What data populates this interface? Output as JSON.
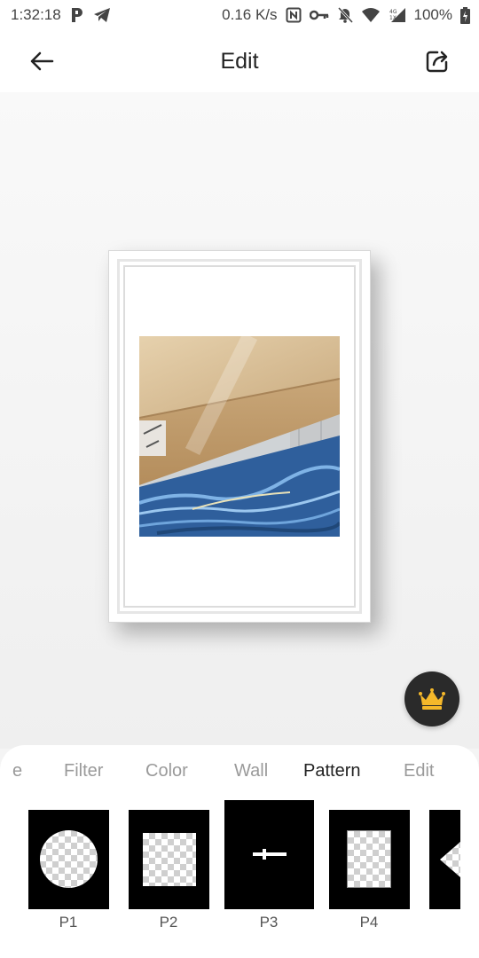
{
  "status_bar": {
    "time": "1:32:18",
    "net_speed": "0.16 K/s",
    "battery": "100%",
    "left_icons": [
      "p-app-icon",
      "telegram-icon"
    ],
    "right_icons": [
      "nfc-icon",
      "key-icon",
      "bell-off-icon",
      "wifi-icon",
      "signal-4g-icon",
      "battery-charging-icon"
    ]
  },
  "app_bar": {
    "title": "Edit",
    "back_icon": "arrow-left-icon",
    "share_icon": "share-icon"
  },
  "editor": {
    "frame_style": "white-frame",
    "premium_icon": "crown-icon",
    "accent_color": "#f5b82a"
  },
  "tabs": [
    {
      "label": "e",
      "active": false
    },
    {
      "label": "Filter",
      "active": false
    },
    {
      "label": "Color",
      "active": false
    },
    {
      "label": "Wall",
      "active": false
    },
    {
      "label": "Pattern",
      "active": true
    },
    {
      "label": "Edit",
      "active": false
    }
  ],
  "patterns": [
    {
      "label": "P1",
      "selected": false
    },
    {
      "label": "P2",
      "selected": false
    },
    {
      "label": "P3",
      "selected": true
    },
    {
      "label": "P4",
      "selected": false
    },
    {
      "label": "",
      "selected": false
    }
  ]
}
